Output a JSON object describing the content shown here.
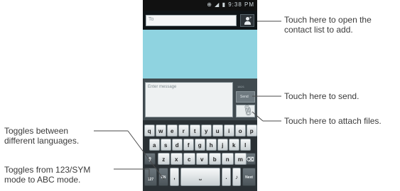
{
  "status_bar": {
    "time": "9:38 PM"
  },
  "compose": {
    "to_placeholder": "To",
    "message_placeholder": "Enter message",
    "counter": "160/1",
    "send_label": "Send"
  },
  "keyboard": {
    "row1": [
      "q",
      "w",
      "e",
      "r",
      "t",
      "y",
      "u",
      "i",
      "o",
      "p"
    ],
    "row2": [
      "a",
      "s",
      "d",
      "f",
      "g",
      "h",
      "j",
      "k",
      "l"
    ],
    "row3": [
      "z",
      "x",
      "c",
      "v",
      "b",
      "n",
      "m"
    ],
    "sym_label": "127",
    "lang_label": "EN",
    "comma": ",",
    "period": ".",
    "next_label": "Next"
  },
  "callouts": {
    "contact": [
      "Touch here to open the",
      "contact list to add."
    ],
    "send": "Touch here to send.",
    "attach": "Touch here to attach files.",
    "languages": [
      "Toggles between",
      "different languages."
    ],
    "mode": [
      "Toggles from 123/SYM",
      "mode to ABC mode."
    ]
  }
}
